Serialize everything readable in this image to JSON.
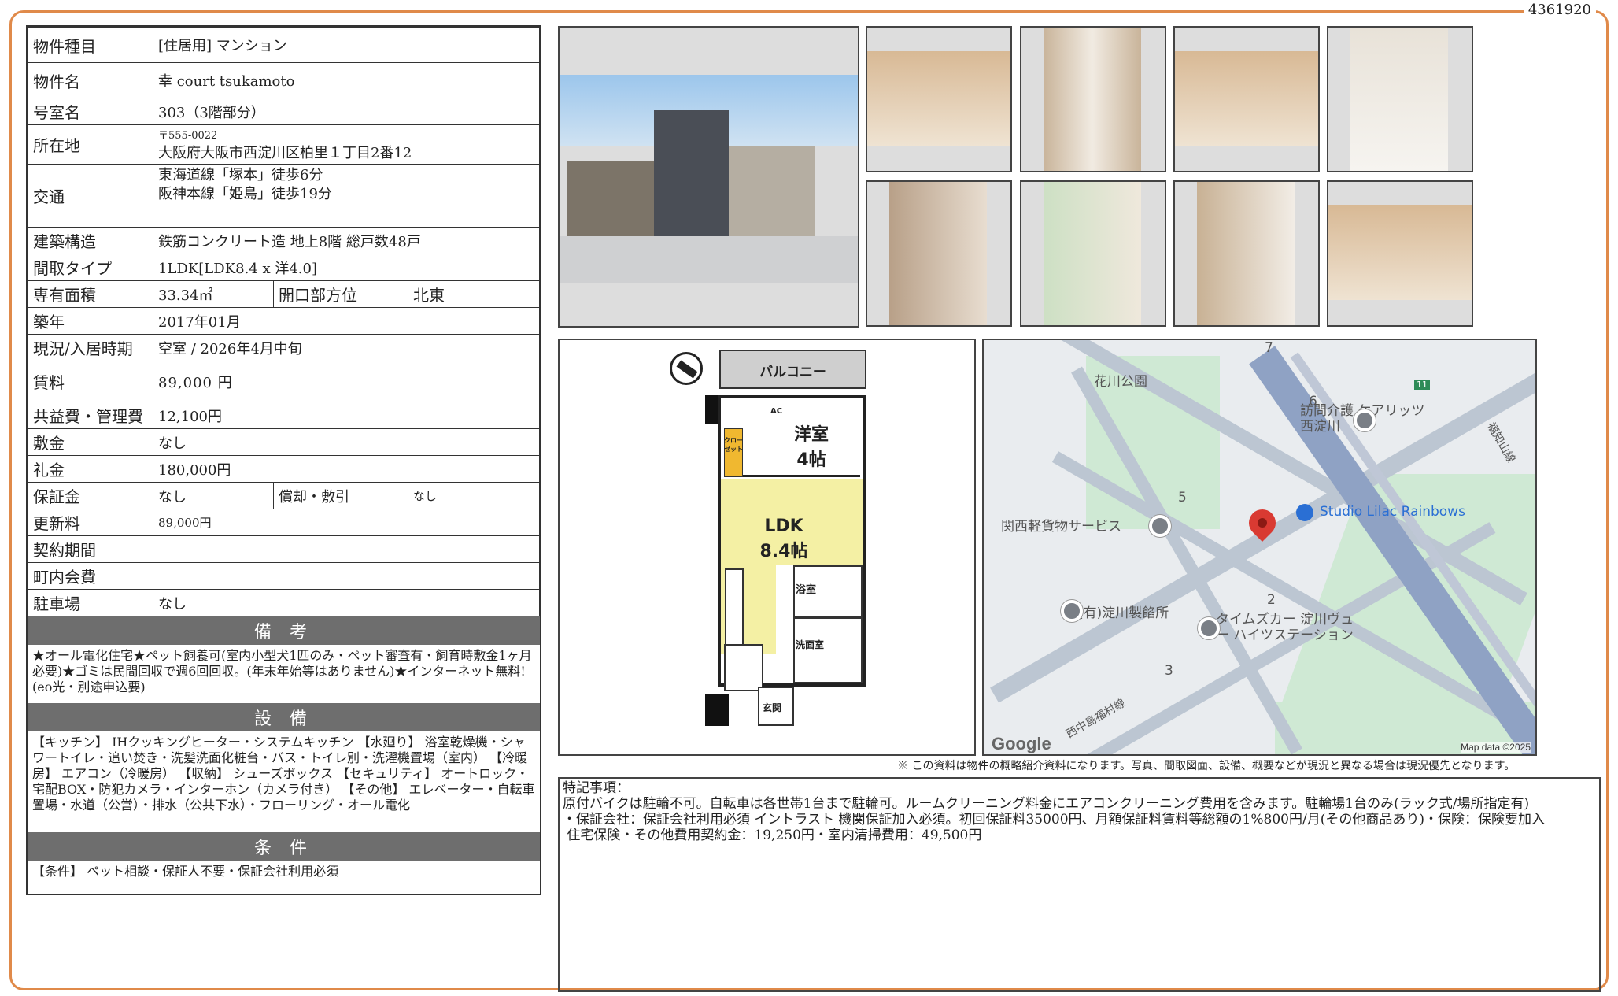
{
  "doc_id": "4361920",
  "spec": {
    "type_label": "物件種目",
    "type_value": "[住居用] マンション",
    "name_label": "物件名",
    "name_value": "幸 court tsukamoto",
    "room_label": "号室名",
    "room_value": "303（3階部分）",
    "addr_label": "所在地",
    "addr_zip": "〒555-0022",
    "addr_value": "大阪府大阪市西淀川区柏里１丁目2番12",
    "access_label": "交通",
    "access_1": "東海道線「塚本」徒歩6分",
    "access_2": "阪神本線「姫島」徒歩19分",
    "struct_label": "建築構造",
    "struct_value": "鉄筋コンクリート造 地上8階 総戸数48戸",
    "layout_label": "間取タイプ",
    "layout_value": "1LDK[LDK8.4 x 洋4.0]",
    "area_label": "専有面積",
    "area_value": "33.34㎡",
    "dir_label": "開口部方位",
    "dir_value": "北東",
    "built_label": "築年",
    "built_value": "2017年01月",
    "status_label": "現況/入居時期",
    "status_value": "空室 / 2026年4月中旬",
    "rent_label": "賃料",
    "rent_value": "89,000 円",
    "fee_label": "共益費・管理費",
    "fee_value": "12,100円",
    "deposit_label": "敷金",
    "deposit_value": "なし",
    "key_label": "礼金",
    "key_value": "180,000円",
    "guar_label": "保証金",
    "guar_value": "なし",
    "amort_label": "償却・敷引",
    "amort_value": "なし",
    "renew_label": "更新料",
    "renew_value": "89,000円",
    "contract_label": "契約期間",
    "contract_value": "",
    "town_label": "町内会費",
    "town_value": "",
    "parking_label": "駐車場",
    "parking_value": "なし"
  },
  "sections": {
    "biko_title": "備 考",
    "biko_text": "★オール電化住宅★ペット飼養可(室内小型犬1匹のみ・ペット審査有・飼育時敷金1ヶ月必要)★ゴミは民間回収で週6回回収。(年末年始等はありません)★インターネット無料!(eo光・別途申込要)",
    "setsubi_title": "設 備",
    "setsubi_text": "【キッチン】 IHクッキングヒーター・システムキッチン 【水廻り】 浴室乾燥機・シャワートイレ・追い焚き・洗髪洗面化粧台・バス・トイレ別・洗濯機置場（室内） 【冷暖房】 エアコン（冷暖房） 【収納】 シューズボックス 【セキュリティ】 オートロック・宅配BOX・防犯カメラ・インターホン（カメラ付き） 【その他】 エレベーター・自転車置場・水道（公営）・排水（公共下水）・フローリング・オール電化",
    "joken_title": "条 件",
    "joken_text": "【条件】 ペット相談・保証人不要・保証会社利用必須"
  },
  "floorplan": {
    "balcony": "バルコニー",
    "western_room": "洋室",
    "western_size": "4帖",
    "ldk": "LDK",
    "ldk_size": "8.4帖",
    "closet": "クロー ゼット",
    "bath": "浴室",
    "washroom": "洗面室",
    "entrance": "玄関",
    "ac": "AC"
  },
  "map": {
    "park": "花川公園",
    "care": "訪問介護 ケアリッツ西淀川",
    "studio": "Studio Lilac Rainbows",
    "cargo": "関西軽貨物サービス",
    "factory": "(有)淀川製餡所",
    "times": "タイムズカー 淀川ヴュー ハイツステーション",
    "line": "福知山線",
    "road": "西中島福村線",
    "route": "11",
    "b2": "2",
    "b3": "3",
    "b5": "5",
    "b6": "6",
    "b7": "7",
    "google": "Google",
    "mapdata": "Map data ©2025"
  },
  "note": "※ この資料は物件の概略紹介資料になります。写真、間取図面、設備、概要などが現況と異なる場合は現況優先となります。",
  "remarks": {
    "title": "特記事項：",
    "line1": "原付バイクは駐輪不可。自転車は各世帯1台まで駐輪可。ルームクリーニング料金にエアコンクリーニング費用を含みます。駐輪場1台のみ(ラック式/場所指定有)",
    "line2": "・保証会社：保証会社利用必須 イントラスト 機関保証加入必須。初回保証料35000円、月額保証料賃料等総額の1%800円/月(その他商品あり)・保険：保険要加入",
    "line3": " 住宅保険・その他費用契約金：19,250円・室内清掃費用：49,500円"
  },
  "colors": {
    "frame": "#e08a4a",
    "section": "#6e6e6e",
    "ldk": "#f4f0a4",
    "closet": "#f0b830",
    "pin": "#d93a32"
  }
}
